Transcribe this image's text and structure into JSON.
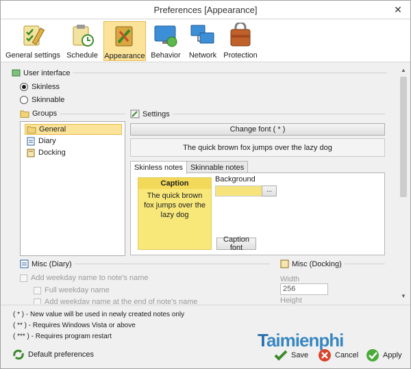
{
  "window": {
    "title": "Preferences [Appearance]",
    "close_glyph": "✕"
  },
  "toolbar": {
    "items": [
      {
        "label": "General settings",
        "icon": "general-settings-icon"
      },
      {
        "label": "Schedule",
        "icon": "schedule-icon"
      },
      {
        "label": "Appearance",
        "icon": "appearance-icon",
        "active": true
      },
      {
        "label": "Behavior",
        "icon": "behavior-icon"
      },
      {
        "label": "Network",
        "icon": "network-icon"
      },
      {
        "label": "Protection",
        "icon": "protection-icon"
      }
    ]
  },
  "user_interface": {
    "header": "User interface",
    "options": [
      {
        "label": "Skinless",
        "selected": true
      },
      {
        "label": "Skinnable",
        "selected": false
      }
    ]
  },
  "groups": {
    "header": "Groups",
    "items": [
      {
        "label": "General",
        "selected": true
      },
      {
        "label": "Diary"
      },
      {
        "label": "Docking"
      }
    ]
  },
  "settings": {
    "header": "Settings",
    "change_font": "Change font ( * )",
    "preview_text": "The quick brown fox jumps over the lazy dog",
    "tabs": [
      {
        "label": "Skinless notes",
        "active": true
      },
      {
        "label": "Skinnable notes"
      }
    ],
    "note": {
      "caption": "Caption",
      "body": "The quick brown fox jumps over the lazy dog"
    },
    "background_label": "Background",
    "background_color": "#f6e37c",
    "ellipsis": "...",
    "caption_font": "Caption font"
  },
  "misc_diary": {
    "header": "Misc (Diary)",
    "checks": [
      "Add weekday name to note's name",
      "Full weekday name",
      "Add weekday name at the end of note's name"
    ]
  },
  "misc_docking": {
    "header": "Misc (Docking)",
    "width_label": "Width",
    "width_value": "256",
    "height_label": "Height"
  },
  "legend": [
    "( * ) - New value will be used in newly created notes only",
    "( ** ) - Requires Windows Vista or above",
    "( *** ) - Requires program restart"
  ],
  "footer": {
    "default_prefs": "Default preferences",
    "save": "Save",
    "cancel": "Cancel",
    "apply": "Apply"
  },
  "watermark": {
    "text": "aimienphi",
    "initial": "T"
  },
  "colors": {
    "accent": "#fbe39a",
    "note": "#f8e87a",
    "caption": "#f3d95a"
  }
}
